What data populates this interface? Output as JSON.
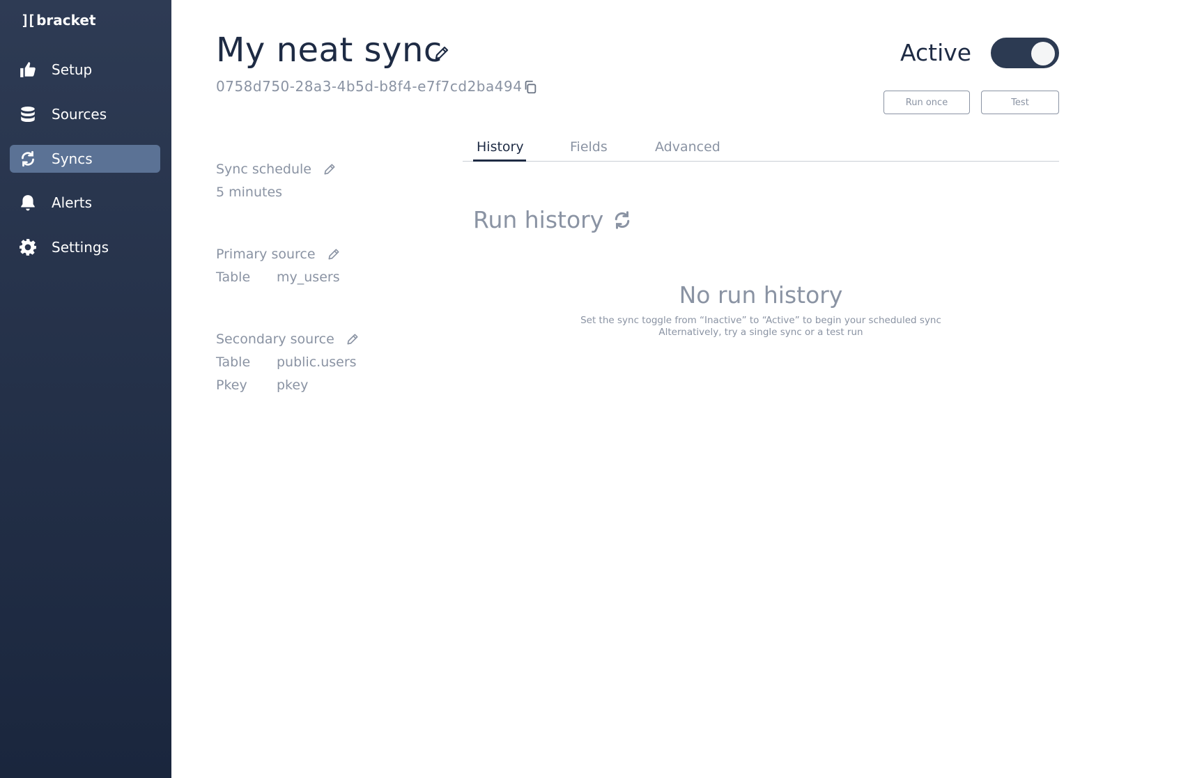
{
  "sidebar": {
    "logo_mark": "][",
    "logo_text": "bracket",
    "items": [
      {
        "label": "Setup",
        "icon": "thumbs-up-icon"
      },
      {
        "label": "Sources",
        "icon": "database-icon"
      },
      {
        "label": "Syncs",
        "icon": "sync-icon",
        "active": true
      },
      {
        "label": "Alerts",
        "icon": "bell-icon"
      },
      {
        "label": "Settings",
        "icon": "gear-icon"
      }
    ]
  },
  "header": {
    "title": "My neat sync",
    "sync_id": "0758d750-28a3-4b5d-b8f4-e7f7cd2ba494",
    "status_label": "Active",
    "toggle_on": true,
    "run_once_label": "Run once",
    "test_label": "Test"
  },
  "details": {
    "schedule": {
      "heading": "Sync schedule",
      "value": "5 minutes"
    },
    "primary_source": {
      "heading": "Primary source",
      "rows": [
        {
          "key": "Table",
          "value": "my_users"
        }
      ]
    },
    "secondary_source": {
      "heading": "Secondary source",
      "rows": [
        {
          "key": "Table",
          "value": "public.users"
        },
        {
          "key": "Pkey",
          "value": "pkey"
        }
      ]
    }
  },
  "tabs": [
    {
      "label": "History",
      "active": true
    },
    {
      "label": "Fields"
    },
    {
      "label": "Advanced"
    }
  ],
  "history": {
    "heading": "Run history",
    "empty_title": "No run history",
    "empty_line1": "Set the sync toggle from “Inactive” to “Active” to begin your scheduled sync",
    "empty_line2": "Alternatively, try a single sync or a test run"
  },
  "colors": {
    "sidebar_top": "#2e3b54",
    "sidebar_bottom": "#1a263d",
    "nav_active": "#5b7295",
    "primary_text": "#1e2b44",
    "muted_text": "#8a93a3"
  }
}
